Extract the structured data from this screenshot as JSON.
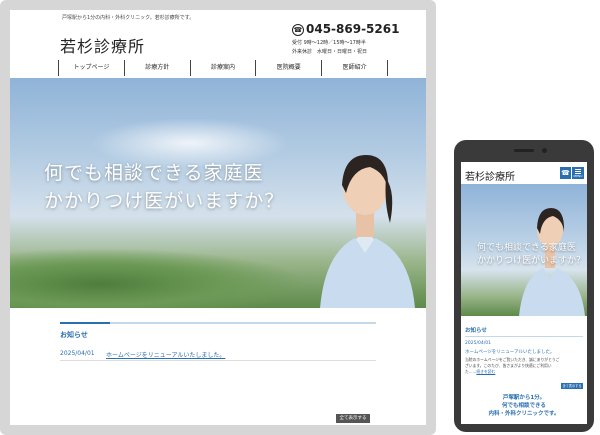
{
  "desktop": {
    "tagline": "戸塚駅から1分の内科・外科クリニック。若杉診療所です。",
    "logo": "若杉診療所",
    "phone": "045-869-5261",
    "hours": "受付 9時～12時／15時～17時半",
    "closed": "外来休診　水曜日・日曜日・祝日",
    "nav": [
      "トップページ",
      "診療方針",
      "診療案内",
      "医院概要",
      "医師紹介"
    ],
    "hero_line1": "何でも相談できる家庭医",
    "hero_line2": "かかりつけ医がいますか？",
    "news_title": "お知らせ",
    "news_date": "2025/04/01",
    "news_link": "ホームページをリニューアルいたしました。",
    "all_button": "全て表示する"
  },
  "mobile": {
    "logo": "若杉診療所",
    "menu_label": "MENU",
    "hero_line1": "何でも相談できる家庭医",
    "hero_line2": "かかりつけ医がいますか？",
    "news_title": "お知らせ",
    "news_date": "2025/04/01",
    "news_link": "ホームページをリニューアルいたしました。",
    "body1": "当院のホームページをご覧いただき、誠にありがとうご",
    "body2": "ざいます。このたび、皆さまがより快適にご利用い",
    "more_prefix": "た……",
    "more_link": "続きを読む",
    "all_button": "全て表示する",
    "footer1": "戸塚駅から1分。",
    "footer2": "何でも相談できる",
    "footer3": "内科・外科クリニックです。"
  },
  "colors": {
    "accent": "#2a6fb0",
    "frame": "#d6d6d6",
    "phone_body": "#3a3a3a"
  }
}
